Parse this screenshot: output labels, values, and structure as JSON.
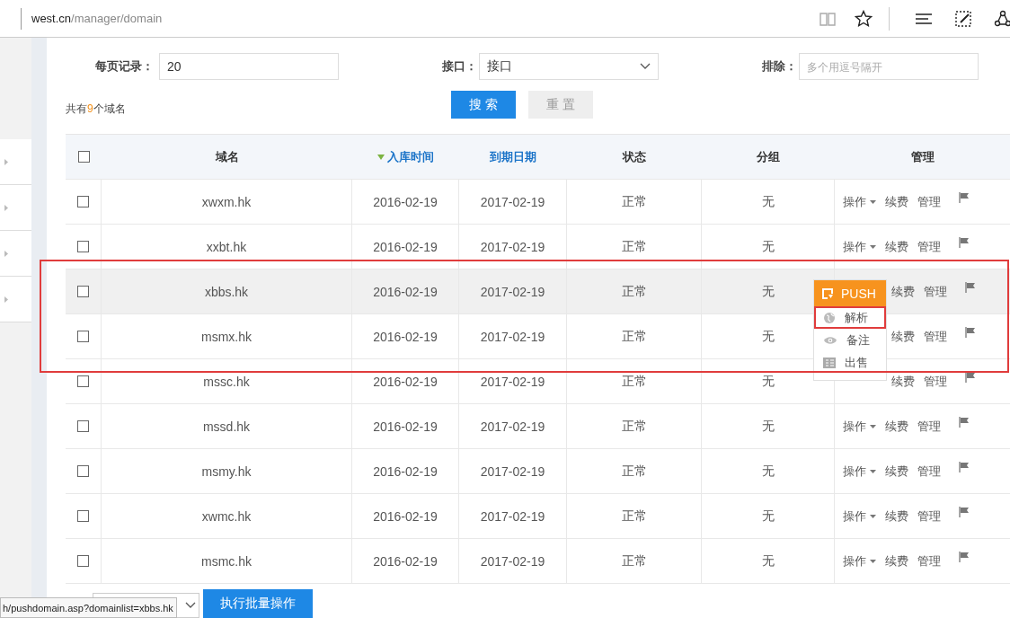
{
  "address_bar": {
    "host": "west.cn",
    "path": "/manager/domain"
  },
  "filters": [
    {
      "label": "每页记录：",
      "kind": "input",
      "value": "20"
    },
    {
      "label": "接口：",
      "kind": "select",
      "value": "接口"
    },
    {
      "label": "排除：",
      "kind": "input",
      "placeholder": "多个用逗号隔开"
    }
  ],
  "buttons": [
    {
      "label": "搜 索",
      "kind": "primary"
    },
    {
      "label": "重 置",
      "kind": "secondary"
    }
  ],
  "total": {
    "prefix": "共有",
    "count": "9",
    "suffix": "个域名"
  },
  "table": {
    "header_checked": false,
    "columns": [
      {
        "label": "域名",
        "sortable": false,
        "sorted": false
      },
      {
        "label": "入库时间",
        "sortable": true,
        "sorted": true
      },
      {
        "label": "到期日期",
        "sortable": true,
        "sorted": false
      },
      {
        "label": "状态",
        "sortable": false,
        "sorted": false
      },
      {
        "label": "分组",
        "sortable": false,
        "sorted": false
      },
      {
        "label": "管理",
        "sortable": false,
        "sorted": false
      }
    ],
    "rows": [
      {
        "checked": false,
        "hovered": false,
        "domain": "xwxm.hk",
        "added": "2016-02-19",
        "expires": "2017-02-19",
        "status": "正常",
        "group": "无",
        "ops": "操作",
        "renew": "续费",
        "manage": "管理"
      },
      {
        "checked": false,
        "hovered": false,
        "domain": "xxbt.hk",
        "added": "2016-02-19",
        "expires": "2017-02-19",
        "status": "正常",
        "group": "无",
        "ops": "操作",
        "renew": "续费",
        "manage": "管理"
      },
      {
        "checked": false,
        "hovered": true,
        "domain": "xbbs.hk",
        "added": "2016-02-19",
        "expires": "2017-02-19",
        "status": "正常",
        "group": "无",
        "renew": "续费",
        "manage": "管理"
      },
      {
        "checked": false,
        "hovered": false,
        "domain": "msmx.hk",
        "added": "2016-02-19",
        "expires": "2017-02-19",
        "status": "正常",
        "group": "无",
        "renew": "续费",
        "manage": "管理"
      },
      {
        "checked": false,
        "hovered": false,
        "domain": "mssc.hk",
        "added": "2016-02-19",
        "expires": "2017-02-19",
        "status": "正常",
        "group": "无",
        "renew": "续费",
        "manage": "管理"
      },
      {
        "checked": false,
        "hovered": false,
        "domain": "mssd.hk",
        "added": "2016-02-19",
        "expires": "2017-02-19",
        "status": "正常",
        "group": "无",
        "ops": "操作",
        "renew": "续费",
        "manage": "管理"
      },
      {
        "checked": false,
        "hovered": false,
        "domain": "msmy.hk",
        "added": "2016-02-19",
        "expires": "2017-02-19",
        "status": "正常",
        "group": "无",
        "ops": "操作",
        "renew": "续费",
        "manage": "管理"
      },
      {
        "checked": false,
        "hovered": false,
        "domain": "xwmc.hk",
        "added": "2016-02-19",
        "expires": "2017-02-19",
        "status": "正常",
        "group": "无",
        "ops": "操作",
        "renew": "续费",
        "manage": "管理"
      },
      {
        "checked": false,
        "hovered": false,
        "domain": "msmc.hk",
        "added": "2016-02-19",
        "expires": "2017-02-19",
        "status": "正常",
        "group": "无",
        "ops": "操作",
        "renew": "续费",
        "manage": "管理"
      }
    ]
  },
  "menu": {
    "items": [
      {
        "label": "PUSH",
        "kind": "push",
        "highlighted": false
      },
      {
        "label": "解析",
        "kind": "globe",
        "highlighted": true
      },
      {
        "label": "备注",
        "kind": "eye",
        "highlighted": false
      },
      {
        "label": "出售",
        "kind": "sale",
        "highlighted": false
      }
    ]
  },
  "batch_button": "执行批量操作",
  "status_url": "h/pushdomain.asp?domainlist=xbbs.hk"
}
